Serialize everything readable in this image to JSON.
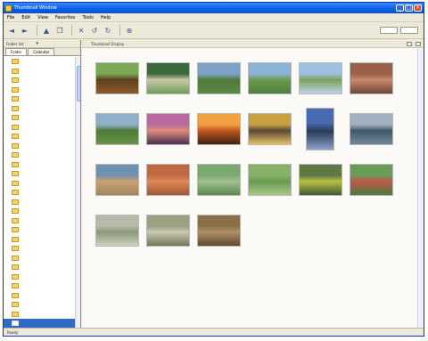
{
  "window": {
    "title": "Thumbnail Window",
    "minimize": "_",
    "maximize": "□",
    "close": "×"
  },
  "menu": [
    "File",
    "Edit",
    "View",
    "Favorites",
    "Tools",
    "Help"
  ],
  "toolbar": {
    "icons": [
      "back-icon",
      "forward-icon",
      "up-icon",
      "copy-icon",
      "delete-icon",
      "rotate-left-icon",
      "rotate-right-icon",
      "zoom-icon"
    ],
    "pill_left": "",
    "pill_right": ""
  },
  "left_pane": {
    "header_label": "Folder list",
    "dropdown": "▾",
    "tabs": [
      "Folder",
      "Calendar"
    ],
    "folders": [
      "",
      "",
      "",
      "",
      "",
      "",
      "",
      "",
      "",
      "",
      "",
      "",
      "",
      "",
      "",
      "",
      "",
      "",
      "",
      "",
      "",
      "",
      "",
      "",
      "",
      "",
      "",
      "",
      ""
    ],
    "selected_index": 28
  },
  "right_pane": {
    "path": "Thumbnail Display"
  },
  "thumbnails": [
    {
      "name": "thumb-brown-dog",
      "colors": [
        "#7aa855",
        "#5e4020",
        "#8b5a2b"
      ]
    },
    {
      "name": "thumb-plant-closeup",
      "colors": [
        "#3d6a3a",
        "#c8c8a8",
        "#6f9e5a"
      ]
    },
    {
      "name": "thumb-field-horizon",
      "colors": [
        "#7fa3c8",
        "#4f7a3a",
        "#5b8a45"
      ]
    },
    {
      "name": "thumb-green-meadow",
      "colors": [
        "#8db3d6",
        "#6b9a4a",
        "#4f8040"
      ]
    },
    {
      "name": "thumb-sky-grass",
      "colors": [
        "#9fbfe0",
        "#7aa05a",
        "#bcd3e8"
      ]
    },
    {
      "name": "thumb-red-rocks",
      "colors": [
        "#9a6048",
        "#c88a6a",
        "#6e4838"
      ]
    },
    {
      "name": "thumb-tall-grass",
      "colors": [
        "#8fb0c8",
        "#4c7a38",
        "#6a9448"
      ]
    },
    {
      "name": "thumb-purple-sunset",
      "colors": [
        "#b86aa0",
        "#e08a7a",
        "#4a3050"
      ]
    },
    {
      "name": "thumb-orange-sunset",
      "colors": [
        "#f0a040",
        "#c05820",
        "#402010"
      ]
    },
    {
      "name": "thumb-market-stall",
      "colors": [
        "#c8a040",
        "#5a4a38",
        "#e0c060"
      ]
    },
    {
      "name": "thumb-tree-portrait",
      "colors": [
        "#4a6ab0",
        "#2a3a58",
        "#8aa0c8"
      ]
    },
    {
      "name": "thumb-lake",
      "colors": [
        "#a0b0c0",
        "#405868",
        "#708898"
      ]
    },
    {
      "name": "thumb-beach",
      "colors": [
        "#7090b0",
        "#c8a070",
        "#a08860"
      ]
    },
    {
      "name": "thumb-red-field",
      "colors": [
        "#c06840",
        "#e08858",
        "#a05838"
      ]
    },
    {
      "name": "thumb-grass-patch",
      "colors": [
        "#7aa870",
        "#a0c090",
        "#5a8850"
      ]
    },
    {
      "name": "thumb-clover",
      "colors": [
        "#88b068",
        "#6a9a50",
        "#a8c888"
      ]
    },
    {
      "name": "thumb-flower-field",
      "colors": [
        "#607848",
        "#b8c040",
        "#405838"
      ]
    },
    {
      "name": "thumb-red-flowers",
      "colors": [
        "#6a9a58",
        "#c05848",
        "#4a7a40"
      ]
    },
    {
      "name": "thumb-stems",
      "colors": [
        "#b8b8a8",
        "#8a9878",
        "#d0d0c0"
      ]
    },
    {
      "name": "thumb-bird-ground",
      "colors": [
        "#9aa080",
        "#c8c8b0",
        "#707858"
      ]
    },
    {
      "name": "thumb-snail",
      "colors": [
        "#8a7048",
        "#b09068",
        "#604830"
      ]
    }
  ],
  "status": {
    "left": "Ready",
    "right": ""
  }
}
